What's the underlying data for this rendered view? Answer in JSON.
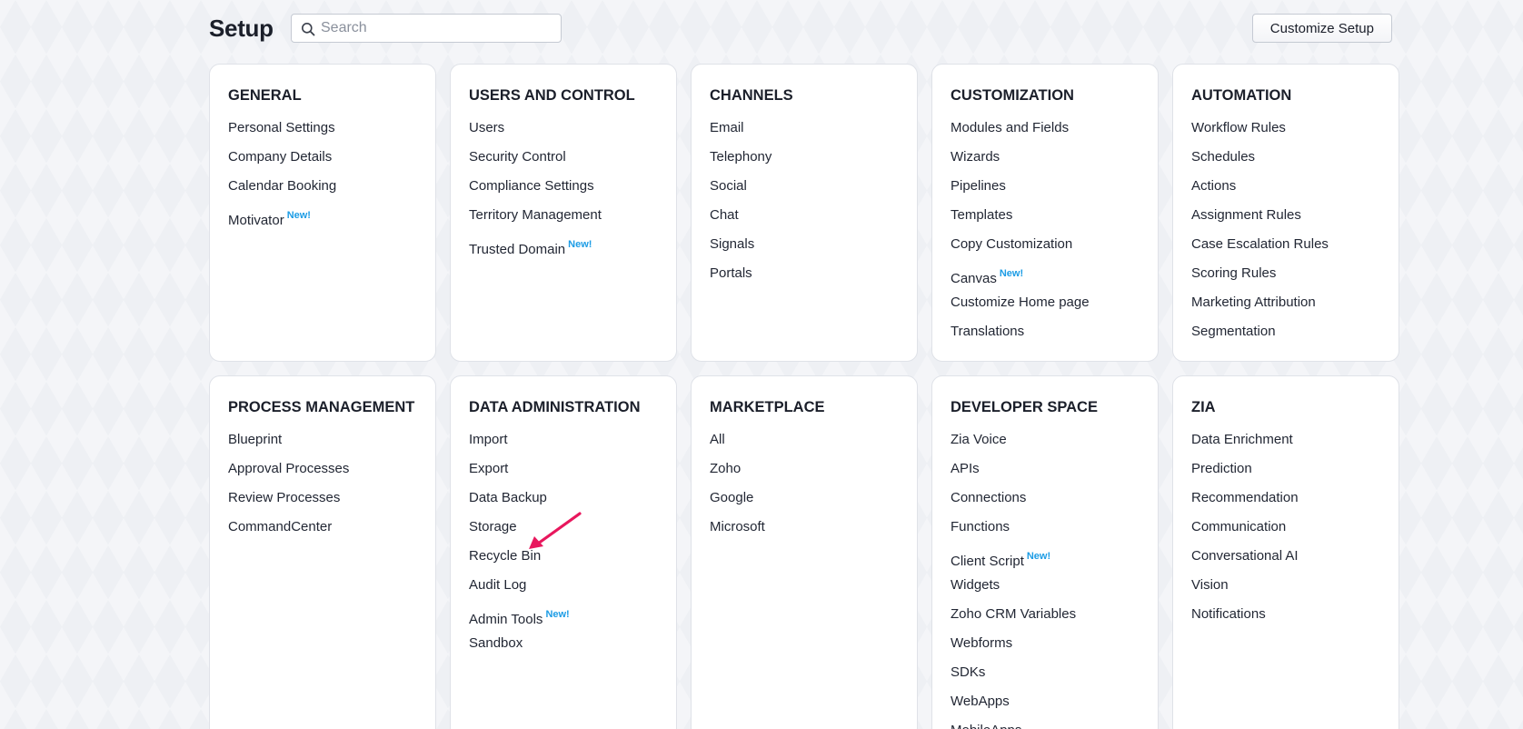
{
  "header": {
    "title": "Setup",
    "search_placeholder": "Search",
    "search_value": "",
    "customize_label": "Customize Setup"
  },
  "new_badge": "New!",
  "colors": {
    "badge": "#1c9ce5",
    "annotation_arrow": "#e8175d"
  },
  "sections": [
    {
      "title": "GENERAL",
      "items": [
        {
          "label": "Personal Settings"
        },
        {
          "label": "Company Details"
        },
        {
          "label": "Calendar Booking"
        },
        {
          "label": "Motivator",
          "badge": "New!"
        }
      ]
    },
    {
      "title": "USERS AND CONTROL",
      "items": [
        {
          "label": "Users"
        },
        {
          "label": "Security Control"
        },
        {
          "label": "Compliance Settings"
        },
        {
          "label": "Territory Management"
        },
        {
          "label": "Trusted Domain",
          "badge": "New!"
        }
      ]
    },
    {
      "title": "CHANNELS",
      "items": [
        {
          "label": "Email"
        },
        {
          "label": "Telephony"
        },
        {
          "label": "Social"
        },
        {
          "label": "Chat"
        },
        {
          "label": "Signals"
        },
        {
          "label": "Portals"
        }
      ]
    },
    {
      "title": "CUSTOMIZATION",
      "items": [
        {
          "label": "Modules and Fields"
        },
        {
          "label": "Wizards"
        },
        {
          "label": "Pipelines"
        },
        {
          "label": "Templates"
        },
        {
          "label": "Copy Customization"
        },
        {
          "label": "Canvas",
          "badge": "New!"
        },
        {
          "label": "Customize Home page"
        },
        {
          "label": "Translations"
        }
      ]
    },
    {
      "title": "AUTOMATION",
      "items": [
        {
          "label": "Workflow Rules"
        },
        {
          "label": "Schedules"
        },
        {
          "label": "Actions"
        },
        {
          "label": "Assignment Rules"
        },
        {
          "label": "Case Escalation Rules"
        },
        {
          "label": "Scoring Rules"
        },
        {
          "label": "Marketing Attribution"
        },
        {
          "label": "Segmentation"
        }
      ]
    },
    {
      "title": "PROCESS MANAGEMENT",
      "items": [
        {
          "label": "Blueprint"
        },
        {
          "label": "Approval Processes"
        },
        {
          "label": "Review Processes"
        },
        {
          "label": "CommandCenter"
        }
      ]
    },
    {
      "title": "DATA ADMINISTRATION",
      "items": [
        {
          "label": "Import"
        },
        {
          "label": "Export"
        },
        {
          "label": "Data Backup"
        },
        {
          "label": "Storage"
        },
        {
          "label": "Recycle Bin"
        },
        {
          "label": "Audit Log"
        },
        {
          "label": "Admin Tools",
          "badge": "New!"
        },
        {
          "label": "Sandbox"
        }
      ]
    },
    {
      "title": "MARKETPLACE",
      "items": [
        {
          "label": "All"
        },
        {
          "label": "Zoho"
        },
        {
          "label": "Google"
        },
        {
          "label": "Microsoft"
        }
      ]
    },
    {
      "title": "DEVELOPER SPACE",
      "items": [
        {
          "label": "Zia Voice"
        },
        {
          "label": "APIs"
        },
        {
          "label": "Connections"
        },
        {
          "label": "Functions"
        },
        {
          "label": "Client Script",
          "badge": "New!"
        },
        {
          "label": "Widgets"
        },
        {
          "label": "Zoho CRM Variables"
        },
        {
          "label": "Webforms"
        },
        {
          "label": "SDKs"
        },
        {
          "label": "WebApps"
        },
        {
          "label": "MobileApps"
        }
      ]
    },
    {
      "title": "ZIA",
      "items": [
        {
          "label": "Data Enrichment"
        },
        {
          "label": "Prediction"
        },
        {
          "label": "Recommendation"
        },
        {
          "label": "Communication"
        },
        {
          "label": "Conversational AI"
        },
        {
          "label": "Vision"
        },
        {
          "label": "Notifications"
        }
      ]
    }
  ]
}
